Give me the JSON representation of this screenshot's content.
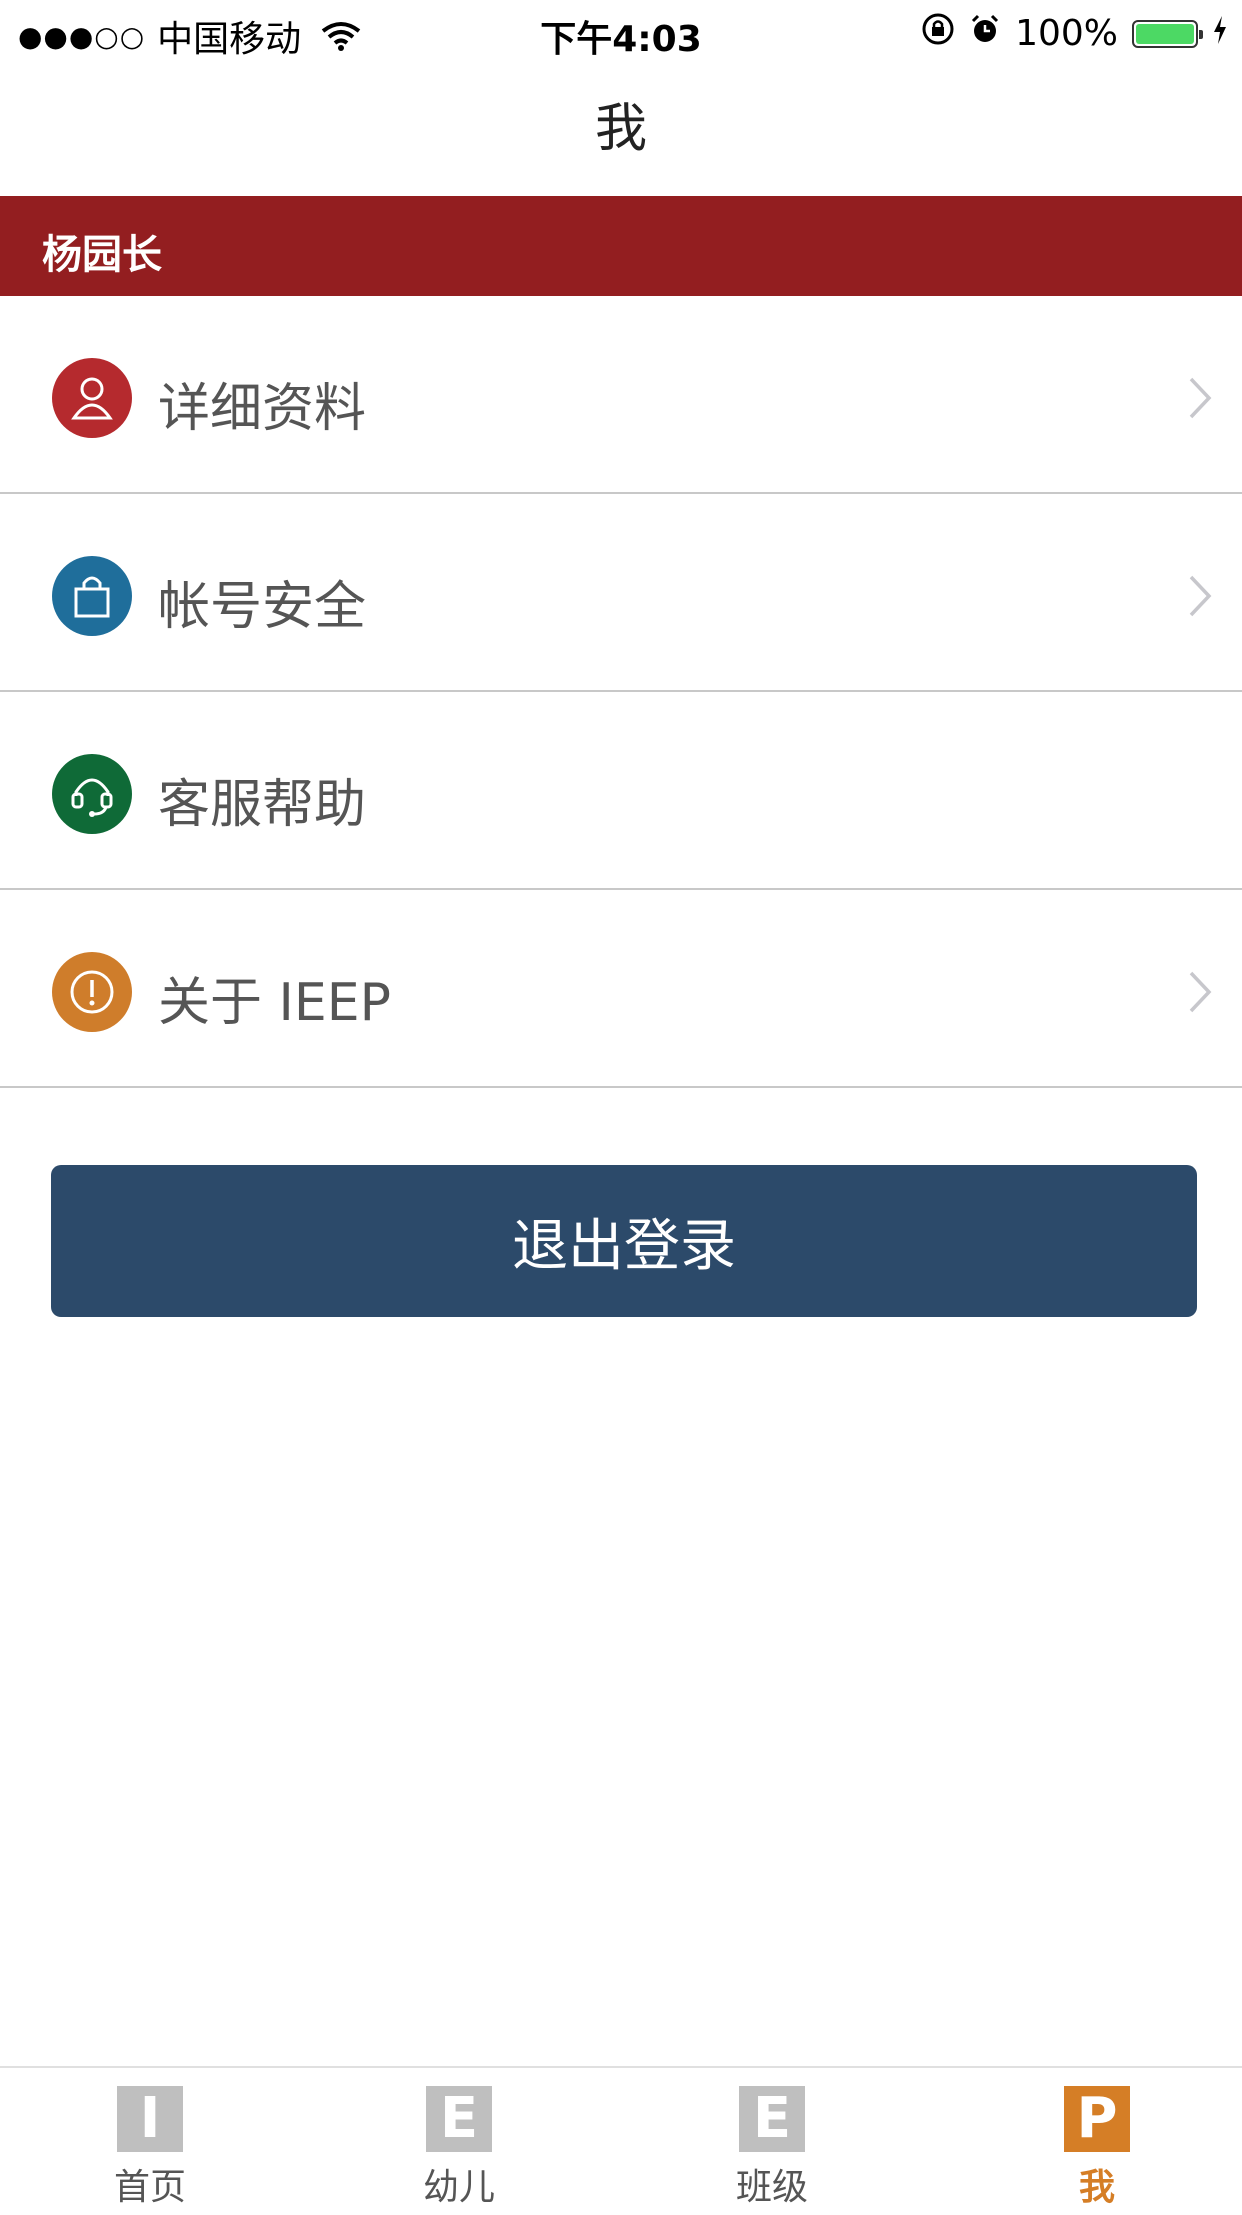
{
  "status_bar": {
    "signal": "●●●○○",
    "carrier": "中国移动",
    "time": "下午4:03",
    "battery": "100%",
    "battery_level": 1.0
  },
  "header": {
    "title": "我"
  },
  "user": {
    "name": "杨园长"
  },
  "menu": {
    "items": [
      {
        "label": "详细资料",
        "icon": "user-icon",
        "color": "#b52a2e",
        "has_chevron": true
      },
      {
        "label": "帐号安全",
        "icon": "lock-icon",
        "color": "#1f6e9b",
        "has_chevron": true
      },
      {
        "label": "客服帮助",
        "icon": "headset-icon",
        "color": "#0f6a37",
        "has_chevron": false
      },
      {
        "label": "关于 IEEP",
        "icon": "info-icon",
        "color": "#cf7d2b",
        "has_chevron": true
      }
    ]
  },
  "logout": {
    "label": "退出登录",
    "color": "#2c4a6a"
  },
  "tabbar": {
    "tabs": [
      {
        "letter": "I",
        "label": "首页",
        "active": false
      },
      {
        "letter": "E",
        "label": "幼儿",
        "active": false
      },
      {
        "letter": "E",
        "label": "班级",
        "active": false
      },
      {
        "letter": "P",
        "label": "我",
        "active": true
      }
    ],
    "active_color": "#d57e26",
    "inactive_color": "#bfbfbf"
  },
  "colors": {
    "banner": "#931e20"
  }
}
